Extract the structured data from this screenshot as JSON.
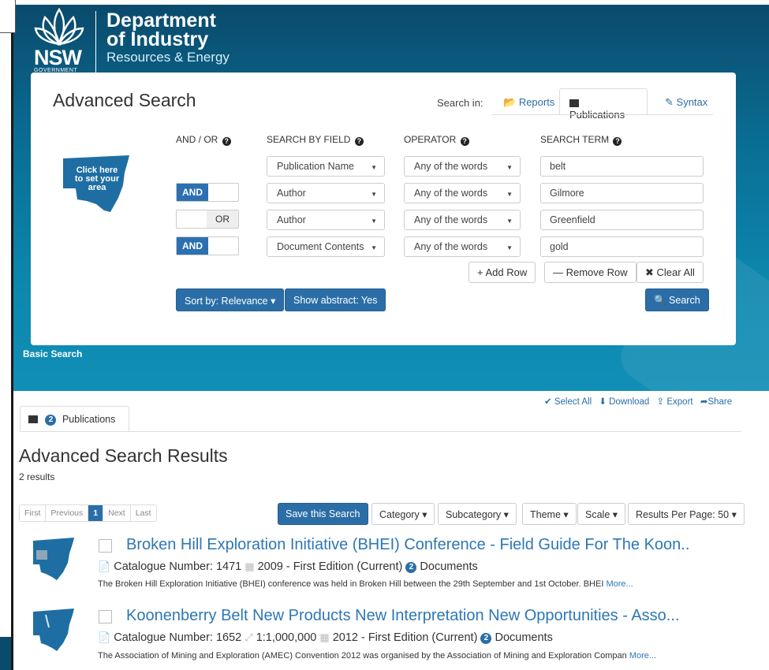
{
  "header": {
    "logo_text": "NSW",
    "logo_subtext": "GOVERNMENT",
    "dept_line1": "Department",
    "dept_line2": "of Industry",
    "dept_line3": "Resources & Energy"
  },
  "panel": {
    "title": "Advanced Search",
    "search_in_label": "Search in:",
    "tabs": [
      {
        "label": "Reports",
        "icon": "folder-icon"
      },
      {
        "label": "Publications",
        "icon": "image-icon",
        "active": true
      },
      {
        "label": "Syntax",
        "icon": "pencil-icon"
      }
    ],
    "columns": {
      "andor": "AND / OR",
      "field": "SEARCH BY FIELD",
      "operator": "OPERATOR",
      "term": "SEARCH TERM"
    },
    "map_label_l1": "Click here",
    "map_label_l2": "to set your",
    "map_label_l3": "area",
    "rows": [
      {
        "logic": "",
        "field": "Publication Name",
        "operator": "Any of the words",
        "term": "belt"
      },
      {
        "logic": "AND",
        "logic_other": "",
        "field": "Author",
        "operator": "Any of the words",
        "term": "Gilmore"
      },
      {
        "logic": "",
        "logic_other": "OR",
        "field": "Author",
        "operator": "Any of the words",
        "term": "Greenfield"
      },
      {
        "logic": "AND",
        "logic_other": "",
        "field": "Document Contents",
        "operator": "Any of the words",
        "term": "gold"
      }
    ],
    "add_row": "+ Add Row",
    "remove_row": "— Remove Row",
    "clear_all": "✖ Clear All",
    "sort_by": "Sort by: Relevance ▾",
    "show_abstract": "Show abstract: Yes",
    "search": "🔍 Search"
  },
  "basic_search": "Basic Search",
  "actions": {
    "select_all": "✔ Select All",
    "download": "⬇ Download",
    "export": "⇪ Export",
    "share": "➦Share"
  },
  "results_tab": {
    "count": "2",
    "label": "Publications"
  },
  "results": {
    "title": "Advanced Search Results",
    "count_text": "2 results",
    "pager": [
      "First",
      "Previous",
      "1",
      "Next",
      "Last"
    ],
    "save_search": "Save this Search",
    "category": "Category ▾",
    "subcategory": "Subcategory ▾",
    "theme": "Theme ▾",
    "scale": "Scale ▾",
    "per_page": "Results Per Page: 50 ▾",
    "items": [
      {
        "title": "Broken Hill Exploration Initiative (BHEI) Conference - Field Guide For The Koon..",
        "catalogue": "Catalogue Number: 1471",
        "scale": "",
        "year_edition": "2009 - First Edition (Current)",
        "doc_count": "2",
        "docs_label": "Documents",
        "description": "The Broken Hill Exploration Initiative (BHEI) conference was held in Broken Hill between the 29th September and 1st October. BHEI",
        "more": "More..."
      },
      {
        "title": "Koonenberry Belt New Products New Interpretation New Opportunities - Asso...",
        "catalogue": "Catalogue Number: 1652",
        "scale": "1:1,000,000",
        "year_edition": "2012 - First Edition (Current)",
        "doc_count": "2",
        "docs_label": "Documents",
        "description": "The Association of Mining and Exploration (AMEC) Convention 2012 was organised by the Association of Mining and Exploration Compan",
        "more": "More..."
      }
    ]
  },
  "colors": {
    "brand_dark": "#0a4a6c",
    "brand_light": "#118fb6",
    "button_blue": "#2b6ea7",
    "link_blue": "#2e77b5"
  }
}
